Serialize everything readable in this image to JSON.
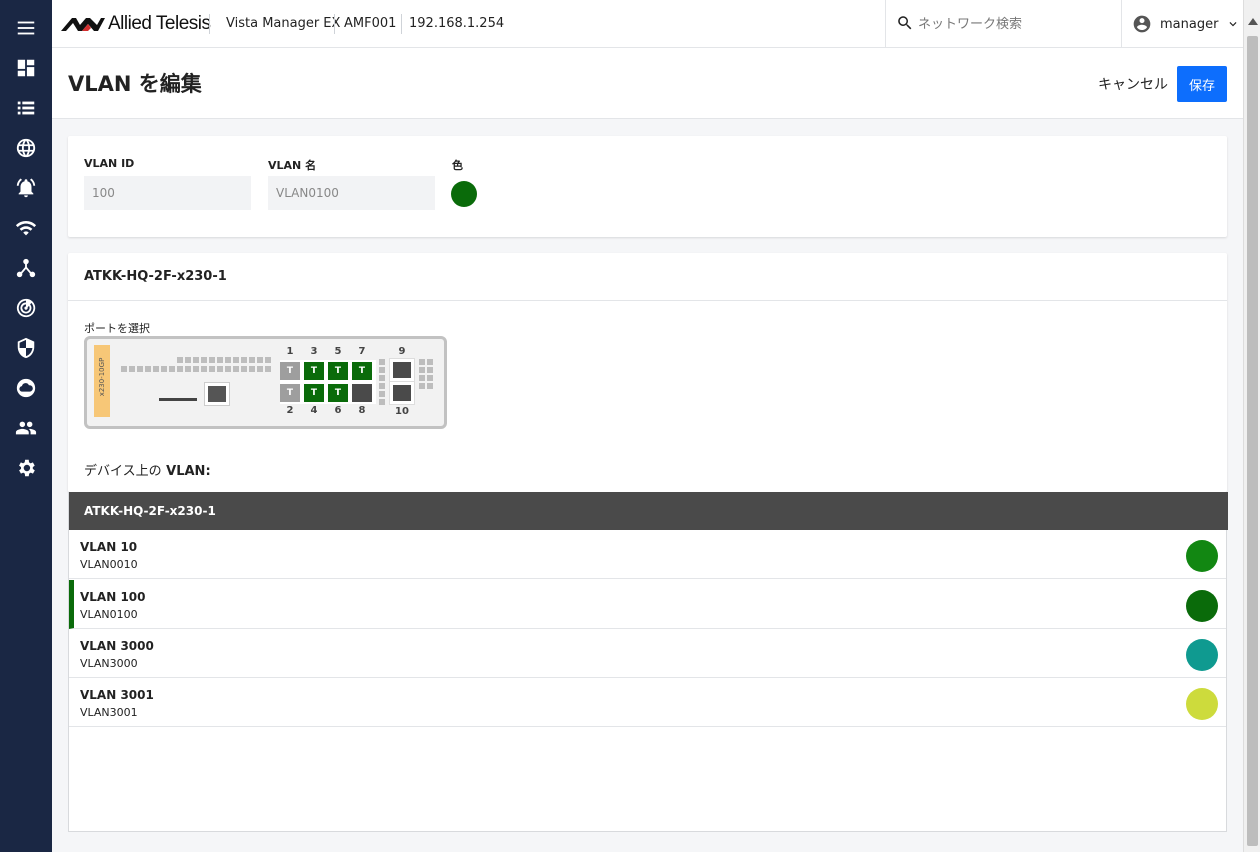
{
  "app": {
    "brand": "Allied Telesis",
    "product": "Vista Manager EX",
    "area": "AMF001",
    "ip": "192.168.1.254"
  },
  "search": {
    "placeholder": "ネットワーク検索"
  },
  "user": {
    "name": "manager"
  },
  "sidebar": {
    "items": [
      {
        "icon": "menu-icon"
      },
      {
        "icon": "dashboard-icon"
      },
      {
        "icon": "list-icon"
      },
      {
        "icon": "globe-icon"
      },
      {
        "icon": "alarm-icon"
      },
      {
        "icon": "wifi-icon"
      },
      {
        "icon": "topology-icon"
      },
      {
        "icon": "radar-icon"
      },
      {
        "icon": "shield-icon"
      },
      {
        "icon": "cloud-icon"
      },
      {
        "icon": "users-icon"
      },
      {
        "icon": "gear-icon"
      }
    ]
  },
  "page": {
    "title": "VLAN を編集",
    "cancel": "キャンセル",
    "save": "保存"
  },
  "form": {
    "id_label": "VLAN ID",
    "id_value": "100",
    "name_label": "VLAN 名",
    "name_value": "VLAN0100",
    "color_label": "色",
    "color": "#0a6b0a"
  },
  "device": {
    "name": "ATKK-HQ-2F-x230-1",
    "select_label": "ポートを選択",
    "model": "x230-10GP",
    "ports": [
      {
        "num": "1",
        "tag": "T",
        "state": "gray"
      },
      {
        "num": "2",
        "tag": "T",
        "state": "gray"
      },
      {
        "num": "3",
        "tag": "T",
        "state": "green"
      },
      {
        "num": "4",
        "tag": "T",
        "state": "green"
      },
      {
        "num": "5",
        "tag": "T",
        "state": "green"
      },
      {
        "num": "6",
        "tag": "T",
        "state": "green"
      },
      {
        "num": "7",
        "tag": "T",
        "state": "green"
      },
      {
        "num": "8",
        "tag": "",
        "state": "dark"
      },
      {
        "num": "9",
        "tag": "",
        "state": "dark"
      },
      {
        "num": "10",
        "tag": "",
        "state": "dark"
      }
    ],
    "vlans_on_device_prefix": "デバイス上の",
    "vlans_on_device_suffix": "VLAN:"
  },
  "vlan_table": {
    "header": "ATKK-HQ-2F-x230-1",
    "rows": [
      {
        "name": "VLAN 10",
        "sub": "VLAN0010",
        "color": "#128712",
        "selected": false
      },
      {
        "name": "VLAN 100",
        "sub": "VLAN0100",
        "color": "#0a6b0a",
        "selected": true
      },
      {
        "name": "VLAN 3000",
        "sub": "VLAN3000",
        "color": "#0f9a90",
        "selected": false
      },
      {
        "name": "VLAN 3001",
        "sub": "VLAN3001",
        "color": "#cddb3c",
        "selected": false
      }
    ]
  }
}
